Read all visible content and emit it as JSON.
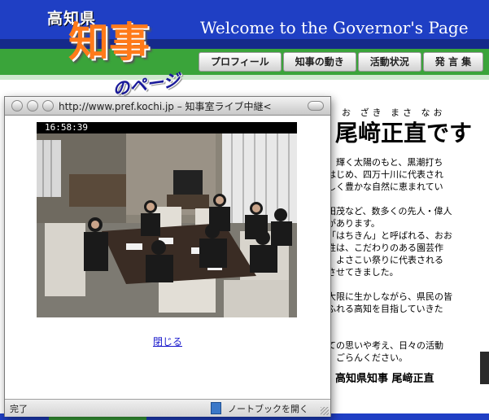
{
  "site": {
    "pref_label": "高知県",
    "logo_main": "知事",
    "logo_sub": "のページ",
    "welcome": "Welcome to the Governor's Page"
  },
  "nav": {
    "items": [
      {
        "label": "プロフィール"
      },
      {
        "label": "知事の動き"
      },
      {
        "label": "活動状況"
      },
      {
        "label": "発 言 集"
      }
    ]
  },
  "governor": {
    "ruby": "お ざき まさ なお",
    "name": "尾﨑正直です",
    "signature": "高知県知事 尾﨑正直"
  },
  "body_lines": [
    "、輝く太陽のもと、黒潮打ち",
    "はじめ、四万十川に代表され",
    "しく豊かな自然に恵まれてい",
    "",
    "田茂など、数多くの先人・偉人",
    "があります。",
    "「はちきん」と呼ばれる、おお",
    "性は、こだわりのある園芸作",
    "、よさこい祭りに代表される",
    "させてきました。",
    "",
    "大限に生かしながら、県民の皆",
    "ふれる高知を目指していきた",
    "",
    "",
    "ての思いや考え、日々の活動",
    "、ごらんください。"
  ],
  "popup": {
    "title": "http://www.pref.kochi.jp – 知事室ライブ中継<",
    "timestamp": "16:58:39",
    "close_link": "閉じる",
    "status": "完了",
    "notebook": "ノートブックを開く"
  },
  "colors": {
    "banner_blue": "#1f3fc4",
    "nav_green": "#3aa43a",
    "logo_orange": "#ff7a1a",
    "link_blue": "#1a1acc"
  }
}
